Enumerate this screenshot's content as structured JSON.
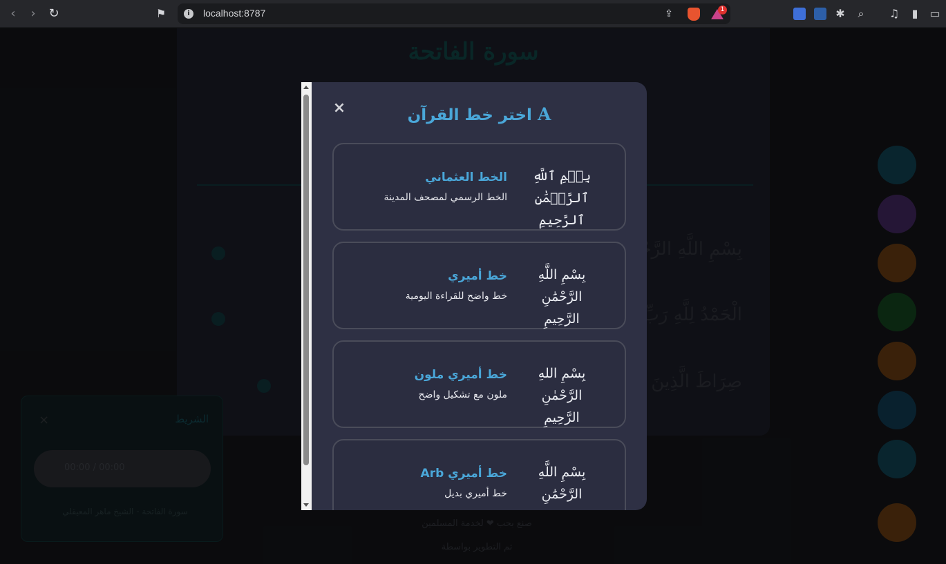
{
  "browser": {
    "url": "localhost:8787",
    "rewards_badge": "1"
  },
  "background": {
    "surah_title": "سورة الفاتحة",
    "ayah_lines": [
      "بِسْمِ اللَّهِ الرَّحْمَٰنِ الرَّحِيمِ",
      "الْحَمْدُ لِلَّهِ رَبِّ الْعَالَمِينَ مُسْتَقِيمَ",
      "صِرَاطَ الَّذِينَ أَنْعَمْتَ عَلَيْهِمْ"
    ],
    "player_title": "الشريط",
    "player_time": "00:00 / 00:00",
    "player_caption": "سورة الفاتحة - الشيخ ماهر المعيقلي",
    "footer_lines": [
      "صنع بحب ❤ لخدمة المسلمين",
      "تم التطوير بواسطة"
    ]
  },
  "modal": {
    "close_label": "×",
    "title_icon": "A",
    "title": "اختر خط القرآن",
    "options": [
      {
        "sample": "بِسۡمِ ٱللَّهِ ٱلرَّحۡمَٰنِ ٱلرَّحِيمِ",
        "name": "الخط العثماني",
        "desc": "الخط الرسمي لمصحف المدينة"
      },
      {
        "sample": "بِسْمِ اللَّهِ الرَّحْمَٰنِ الرَّحِيمِ",
        "name": "خط أميري",
        "desc": "خط واضح للقراءة اليومية"
      },
      {
        "sample": "بِسْمِ اللهِ الرَّحْمٰنِ الرَّحِيمِ",
        "name": "خط أميري ملون",
        "desc": "ملون مع تشكيل واضح"
      },
      {
        "sample": "بِسْمِ اللَّهِ الرَّحْمَٰنِ الرَّحِيمِ",
        "name": "خط أميري Arb",
        "desc": "خط أميري بديل"
      }
    ]
  },
  "colors": {
    "accent": "#4aa7d9",
    "modal_bg": "#2e3044",
    "card_border": "#4a4c5a"
  }
}
